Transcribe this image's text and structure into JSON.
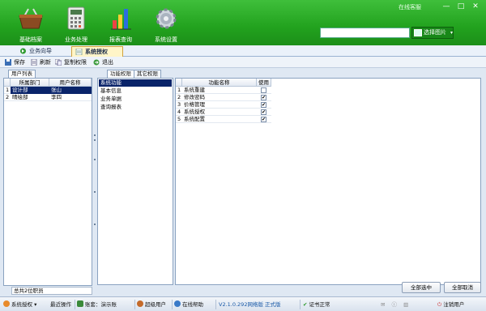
{
  "window": {
    "online_service": "在线客服",
    "min": "—",
    "max": "□",
    "close": "✕"
  },
  "nav": [
    {
      "label": "基础档案",
      "icon": "basket-icon"
    },
    {
      "label": "业务处理",
      "icon": "calculator-icon"
    },
    {
      "label": "报表查询",
      "icon": "bar-chart-icon"
    },
    {
      "label": "系统设置",
      "icon": "gear-icon"
    }
  ],
  "search": {
    "value": "",
    "button": "选择图片"
  },
  "tabs": [
    {
      "label": "业务向导"
    },
    {
      "label": "系统授权"
    }
  ],
  "toolbar": {
    "save": "保存",
    "refresh": "刷新",
    "copy": "复制权限",
    "exit": "退出"
  },
  "left": {
    "tab": "用户列表",
    "columns": [
      "所属部门",
      "用户名称"
    ],
    "rows": [
      {
        "no": "1",
        "dept": "设计部",
        "name": "张山"
      },
      {
        "no": "2",
        "dept": "晴绘部",
        "name": "李四"
      }
    ],
    "footer": "总共2位职员"
  },
  "right": {
    "tabs": [
      "功能权限",
      "其它权限"
    ],
    "modules": [
      "系统功能",
      "基本信息",
      "业务单据",
      "查询报表"
    ],
    "columns": [
      "功能名称",
      "使用"
    ],
    "rows": [
      {
        "no": "1",
        "name": "系统重建",
        "checked": false
      },
      {
        "no": "2",
        "name": "修改密码",
        "checked": true
      },
      {
        "no": "3",
        "name": "价格管理",
        "checked": true
      },
      {
        "no": "4",
        "name": "系统授权",
        "checked": true
      },
      {
        "no": "5",
        "name": "系统配置",
        "checked": true
      }
    ],
    "select_all": "全部选中",
    "cancel_all": "全部取消"
  },
  "statusbar": {
    "auth": "系统授权",
    "recent": "最近操作",
    "account": "账套：演示账",
    "user": "超级用户",
    "help": "在线帮助",
    "version": "V2.1.0.292网络版 正式版",
    "cert": "证书正常",
    "logout": "注销用户"
  },
  "colors": {
    "header": "#22a21e",
    "selection": "#0a246a"
  }
}
